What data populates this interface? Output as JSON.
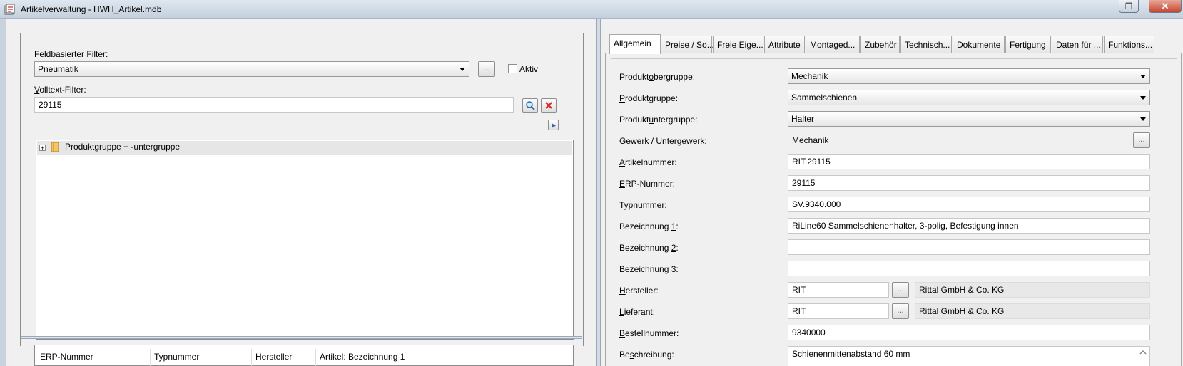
{
  "window": {
    "title": "Artikelverwaltung - HWH_Artikel.mdb",
    "close_glyph": "✕",
    "restore_glyph": "❐"
  },
  "filter": {
    "field_label_hot": "F",
    "field_label_rest": "eldbasierter Filter:",
    "field_value": "Pneumatik",
    "ellipsis": "...",
    "aktiv_label": "Aktiv",
    "fulltext_label_hot": "V",
    "fulltext_label_rest": "olltext-Filter:",
    "fulltext_value": "29115"
  },
  "tree": {
    "root_label": "Produktgruppe + -untergruppe",
    "expander": "+"
  },
  "table": {
    "columns": [
      "ERP-Nummer",
      "Typnummer",
      "Hersteller",
      "Artikel: Bezeichnung 1"
    ]
  },
  "tabs": [
    {
      "label": "Allgemein",
      "active": true
    },
    {
      "label": "Preise / So..."
    },
    {
      "label": "Freie Eige..."
    },
    {
      "label": "Attribute"
    },
    {
      "label": "Montaged..."
    },
    {
      "label": "Zubehör"
    },
    {
      "label": "Technisch..."
    },
    {
      "label": "Dokumente"
    },
    {
      "label": "Fertigung"
    },
    {
      "label": "Daten für ..."
    },
    {
      "label": "Funktions..."
    }
  ],
  "form": {
    "produktobergruppe": {
      "pre": "Produkt",
      "hot": "o",
      "post": "bergruppe:",
      "value": "Mechanik"
    },
    "produktgruppe": {
      "pre": "",
      "hot": "P",
      "post": "roduktgruppe:",
      "value": "Sammelschienen"
    },
    "produktuntergruppe": {
      "pre": "Produkt",
      "hot": "u",
      "post": "ntergruppe:",
      "value": "Halter"
    },
    "gewerk": {
      "pre": "",
      "hot": "G",
      "post": "ewerk / Untergewerk:",
      "value": "Mechanik"
    },
    "artikelnummer": {
      "pre": "",
      "hot": "A",
      "post": "rtikelnummer:",
      "value": "RIT.29115"
    },
    "erp": {
      "pre": "",
      "hot": "E",
      "post": "RP-Nummer:",
      "value": "29115"
    },
    "typnummer": {
      "pre": "",
      "hot": "T",
      "post": "ypnummer:",
      "value": "SV.9340.000"
    },
    "bez1": {
      "pre": "Bezeichnung ",
      "hot": "1",
      "post": ":",
      "value": "RiLine60 Sammelschienenhalter, 3-polig, Befestigung innen"
    },
    "bez2": {
      "pre": "Bezeichnung ",
      "hot": "2",
      "post": ":",
      "value": ""
    },
    "bez3": {
      "pre": "Bezeichnung ",
      "hot": "3",
      "post": ":",
      "value": ""
    },
    "hersteller": {
      "pre": "",
      "hot": "H",
      "post": "ersteller:",
      "value": "RIT",
      "name": "Rittal GmbH & Co. KG"
    },
    "lieferant": {
      "pre": "",
      "hot": "L",
      "post": "ieferant:",
      "value": "RIT",
      "name": "Rittal GmbH & Co. KG"
    },
    "bestellnummer": {
      "pre": "",
      "hot": "B",
      "post": "estellnummer:",
      "value": "9340000"
    },
    "beschreibung": {
      "pre": "Be",
      "hot": "s",
      "post": "chreibung:",
      "value": "Schienenmittenabstand 60 mm"
    }
  }
}
